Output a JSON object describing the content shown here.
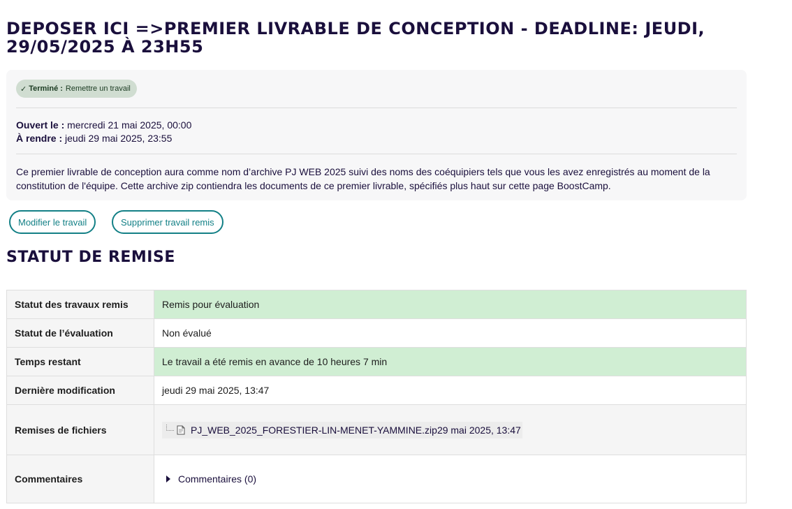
{
  "title": "DEPOSER ICI =>PREMIER LIVRABLE DE CONCEPTION - DEADLINE: JEUDI, 29/05/2025 À 23H55",
  "completion": {
    "status_label": "Terminé :",
    "status_text": "Remettre un travail"
  },
  "dates": {
    "opened_label": "Ouvert le :",
    "opened_value": "mercredi 21 mai 2025, 00:00",
    "due_label": "À rendre :",
    "due_value": "jeudi 29 mai 2025, 23:55"
  },
  "description": "Ce premier livrable de conception aura comme nom d’archive PJ WEB 2025 suivi des noms des coéquipiers tels que vous les avez enregistrés au moment de la constitution de l'équipe. Cette archive zip contiendra les documents de ce premier livrable, spécifiés plus haut sur cette page BoostCamp.",
  "actions": {
    "edit_label": "Modifier le travail",
    "delete_label": "Supprimer travail remis"
  },
  "submission": {
    "section_title": "STATUT DE REMISE",
    "rows": [
      {
        "label": "Statut des travaux remis",
        "value": "Remis pour évaluation"
      },
      {
        "label": "Statut de l’évaluation",
        "value": "Non évalué"
      },
      {
        "label": "Temps restant",
        "value": "Le travail a été remis en avance de 10 heures 7 min"
      },
      {
        "label": "Dernière modification",
        "value": "jeudi 29 mai 2025, 13:47"
      },
      {
        "label": "Remises de fichiers",
        "file_name": "PJ_WEB_2025_FORESTIER-LIN-MENET-YAMMINE.zip",
        "file_date": "29 mai 2025, 13:47"
      },
      {
        "label": "Commentaires",
        "comments_label": "Commentaires (0)"
      }
    ]
  },
  "colors": {
    "accent": "#138086",
    "heading": "#1a0f3c",
    "success_row": "#d0eed3",
    "badge_bg": "#d0ddd1"
  }
}
